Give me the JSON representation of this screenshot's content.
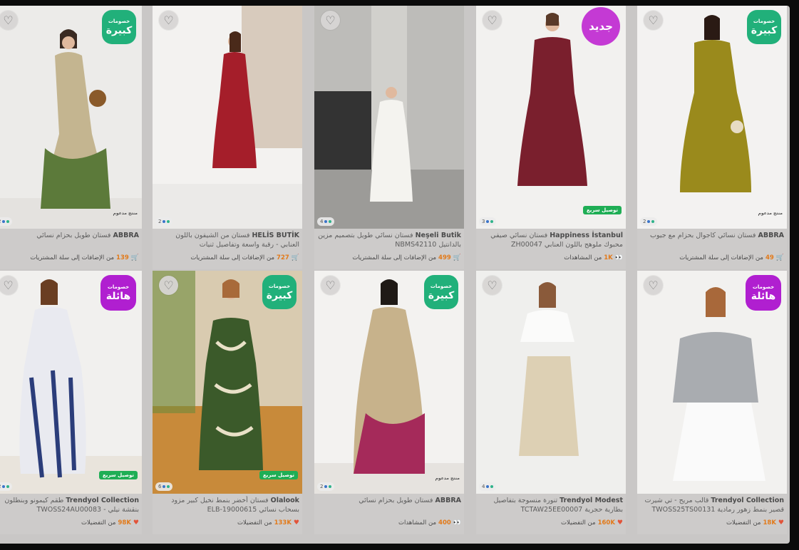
{
  "ui": {
    "favorite_icon": "heart-outline-icon",
    "dots_icon": "color-options-icon"
  },
  "badges": {
    "big_discount_small": "خصومات",
    "big_discount_big": "كبيرة",
    "huge_discount_small": "خصومات",
    "huge_discount_big": "هائلة",
    "new": "جديد",
    "fast_delivery": "توصيل سريع",
    "sponsored": "منتج مدعوم"
  },
  "products": [
    {
      "brand": "ABBRA",
      "name": "فستان طويل بحزام نسائي",
      "colors": "2",
      "stat_value": "139",
      "stat_text": "من الإضافات إلى سلة المشتريات",
      "stat_icon": "cart-add-icon"
    },
    {
      "brand": "HELİS BUTİK",
      "name": "فستان من الشيفون باللون العنابي - رقبة واسعة وتفاصيل ثنيات",
      "colors": "2",
      "stat_value": "727",
      "stat_text": "من الإضافات إلى سلة المشتريات",
      "stat_icon": "cart-add-icon"
    },
    {
      "brand": "Neşeli Butik",
      "name": "فستان نسائي طويل بتصميم مزين بالدانتيل NBMS42110",
      "colors": "4",
      "stat_value": "499",
      "stat_text": "من الإضافات إلى سلة المشتريات",
      "stat_icon": "cart-add-icon"
    },
    {
      "brand": "Happiness İstanbul",
      "name": "فستان نسائي صيفي محبوك ملوهج باللون العنابي ZH00047",
      "colors": "3",
      "stat_value": "1K",
      "stat_text": "من المشاهدات",
      "stat_icon": "eyes-icon"
    },
    {
      "brand": "ABBRA",
      "name": "فستان نسائي كاجوال بحزام مع جيوب",
      "colors": "2",
      "stat_value": "49",
      "stat_text": "من الإضافات إلى سلة المشتريات",
      "stat_icon": "cart-add-icon"
    },
    {
      "brand": "Trendyol Collection",
      "name": "طقم كيمونو وبنطلون بنقشة نيلي - TWOSS24AU00083",
      "colors": "2",
      "stat_value": "98K",
      "stat_text": "من التفضيلات",
      "stat_icon": "heart-icon"
    },
    {
      "brand": "Olalook",
      "name": "فستان أخضر بنمط نخيل كبير مزود بسحاب نسائي ELB-19000615",
      "colors": "6",
      "stat_value": "133K",
      "stat_text": "من التفضيلات",
      "stat_icon": "heart-icon"
    },
    {
      "brand": "ABBRA",
      "name": "فستان طويل بحزام نسائي",
      "colors": "2",
      "stat_value": "400",
      "stat_text": "من المشاهدات",
      "stat_icon": "eyes-icon"
    },
    {
      "brand": "Trendyol Modest",
      "name": "تنورة منسوجة بتفاصيل بطارية حجرية TCTAW25EE00007",
      "colors": "4",
      "stat_value": "160K",
      "stat_text": "من التفضيلات",
      "stat_icon": "heart-icon"
    },
    {
      "brand": "Trendyol Collection",
      "name": "قالب مريح - تي شيرت قصير بنمط زهور رمادية TWOSS25TS00131",
      "colors": "",
      "stat_value": "18K",
      "stat_text": "من التفضيلات",
      "stat_icon": "heart-icon"
    }
  ],
  "colors": {
    "discount_green": "#21b07a",
    "discount_purple": "#b01fd0",
    "new_badge": "#c43ad4",
    "fast_delivery": "#1fae55",
    "stat_number": "#e27a1a"
  }
}
